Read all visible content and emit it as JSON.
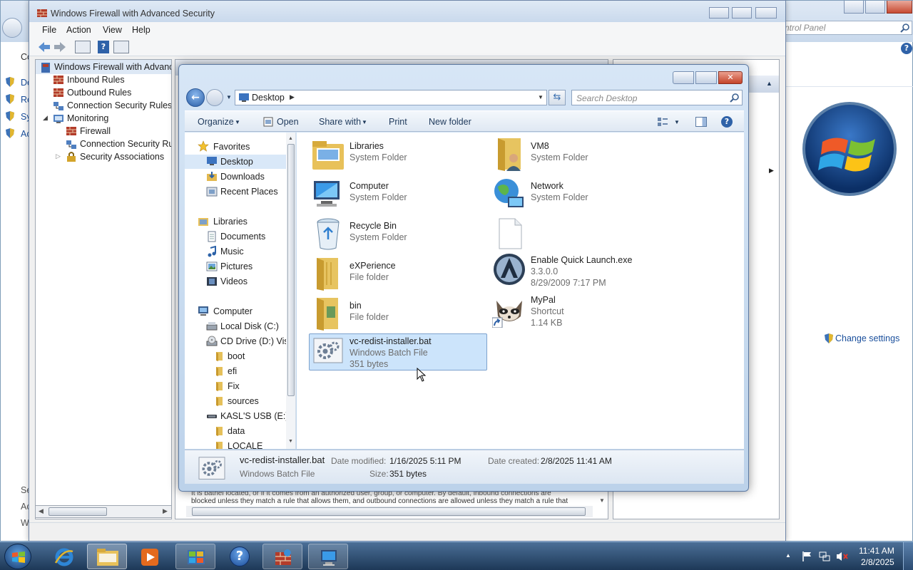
{
  "firewall": {
    "title": "Windows Firewall with Advanced Security",
    "menu": [
      "File",
      "Action",
      "View",
      "Help"
    ],
    "tree": {
      "root": "Windows Firewall with Advanced Security",
      "items": [
        "Inbound Rules",
        "Outbound Rules",
        "Connection Security Rules",
        "Monitoring",
        "Firewall",
        "Connection Security Rules",
        "Security Associations"
      ]
    },
    "description": {
      "line1": "It is bathel located, or if it comes from an authorized user, group, or computer. By default, inbound connections are",
      "line2": "blocked unless they match a rule that allows them, and outbound connections are allowed unless they match a rule that"
    }
  },
  "control_panel": {
    "search_placeholder": "ntrol Panel",
    "change_settings": "Change settings",
    "left_letters": [
      "Co",
      "De",
      "Re",
      "Sy",
      "Ac",
      "Se",
      "Ac",
      "W"
    ]
  },
  "explorer": {
    "address": {
      "location": "Desktop",
      "search_placeholder": "Search Desktop"
    },
    "toolbar": {
      "organize": "Organize",
      "open": "Open",
      "share_with": "Share with",
      "print": "Print",
      "new_folder": "New folder"
    },
    "nav": {
      "favorites_header": "Favorites",
      "favorites": [
        "Desktop",
        "Downloads",
        "Recent Places"
      ],
      "libraries_header": "Libraries",
      "libraries": [
        "Documents",
        "Music",
        "Pictures",
        "Videos"
      ],
      "computer_header": "Computer",
      "drives": [
        "Local Disk (C:)",
        "CD Drive (D:) Vist"
      ],
      "cd_folders": [
        "boot",
        "efi",
        "Fix",
        "sources"
      ],
      "usb": "KASL'S USB (E:)",
      "usb_folders": [
        "data",
        "LOCALE"
      ]
    },
    "items": [
      {
        "name": "Libraries",
        "line2": "System Folder",
        "line3": ""
      },
      {
        "name": "VM8",
        "line2": "System Folder",
        "line3": ""
      },
      {
        "name": "Computer",
        "line2": "System Folder",
        "line3": ""
      },
      {
        "name": "Network",
        "line2": "System Folder",
        "line3": ""
      },
      {
        "name": "Recycle Bin",
        "line2": "System Folder",
        "line3": ""
      },
      {
        "name": "",
        "line2": "",
        "line3": ""
      },
      {
        "name": "eXPerience",
        "line2": "File folder",
        "line3": ""
      },
      {
        "name": "Enable Quick Launch.exe",
        "line2": "3.3.0.0",
        "line3": "8/29/2009 7:17 PM"
      },
      {
        "name": "bin",
        "line2": "File folder",
        "line3": ""
      },
      {
        "name": "MyPal",
        "line2": "Shortcut",
        "line3": "1.14 KB"
      },
      {
        "name": "vc-redist-installer.bat",
        "line2": "Windows Batch File",
        "line3": "351 bytes"
      }
    ],
    "details": {
      "name": "vc-redist-installer.bat",
      "type": "Windows Batch File",
      "date_modified_label": "Date modified:",
      "date_modified": "1/16/2025 5:11 PM",
      "size_label": "Size:",
      "size": "351 bytes",
      "date_created_label": "Date created:",
      "date_created": "2/8/2025 11:41 AM"
    }
  },
  "taskbar": {
    "time": "11:41 AM",
    "date": "2/8/2025"
  },
  "colors": {
    "accent": "#3c6fb0",
    "selection": "#cce4fb",
    "selection_border": "#7da2ce",
    "link": "#1a4f9c"
  }
}
